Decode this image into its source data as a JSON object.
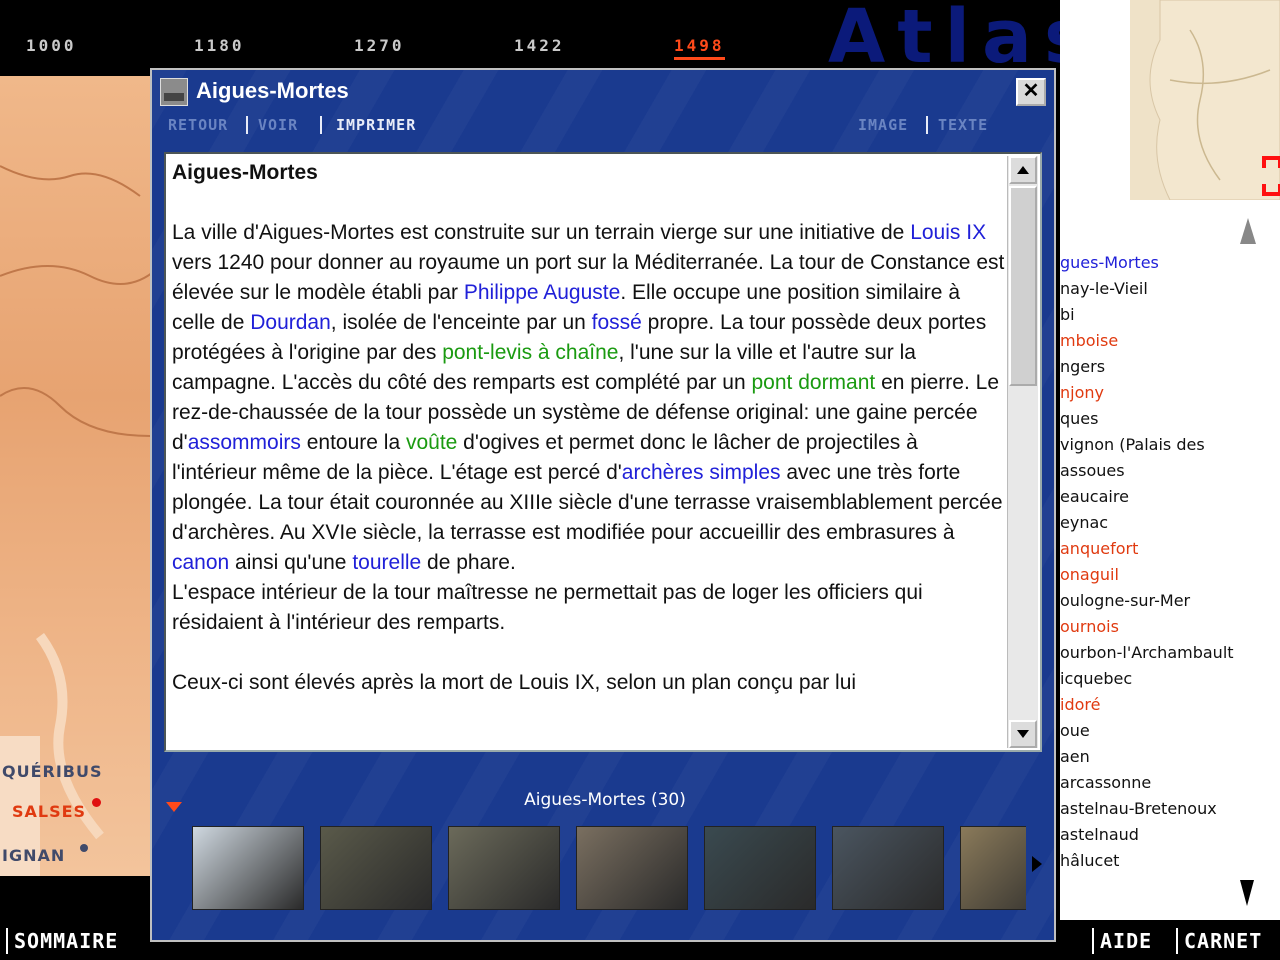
{
  "timeline": {
    "years": [
      "1000",
      "1180",
      "1270",
      "1422",
      "1498"
    ],
    "active": "1498",
    "logo": "Atlas"
  },
  "map_labels": {
    "queribus": "QUÉRIBUS",
    "salses": "SALSES",
    "ignan": "IGNAN"
  },
  "dialog": {
    "title": "Aigues-Mortes",
    "toolbar": {
      "retour": "RETOUR",
      "voir": "VOIR",
      "imprimer": "IMPRIMER",
      "image": "IMAGE",
      "texte": "TEXTE"
    },
    "close_label": "✕",
    "article": {
      "heading": "Aigues-Mortes",
      "segments": [
        {
          "t": "La ville d'Aigues-Mortes est construite sur un terrain vierge  sur une initiative de "
        },
        {
          "t": "Louis IX",
          "link": "blue"
        },
        {
          "t": " vers 1240 pour donner au royaume un port sur la Méditerranée. La tour de Constance est élevée sur le modèle établi par "
        },
        {
          "t": "Philippe Auguste",
          "link": "blue"
        },
        {
          "t": ". Elle occupe une position similaire à celle de "
        },
        {
          "t": "Dourdan",
          "link": "blue"
        },
        {
          "t": ", isolée de l'enceinte par un "
        },
        {
          "t": "fossé",
          "link": "blue"
        },
        {
          "t": " propre. La tour possède deux portes protégées à l'origine par des "
        },
        {
          "t": "pont-levis à chaîne",
          "link": "green"
        },
        {
          "t": ", l'une sur la ville et l'autre sur la campagne. L'accès du côté des remparts est complété par un "
        },
        {
          "t": "pont dormant",
          "link": "green"
        },
        {
          "t": " en pierre. Le rez-de-chaussée de la tour possède un système de défense original: une gaine percée d'"
        },
        {
          "t": "assommoirs",
          "link": "blue"
        },
        {
          "t": " entoure la "
        },
        {
          "t": "voûte",
          "link": "green"
        },
        {
          "t": " d'ogives et permet donc le lâcher de projectiles à l'intérieur même de la pièce. L'étage est percé d'"
        },
        {
          "t": "archères simples",
          "link": "blue"
        },
        {
          "t": " avec une très forte plongée. La tour était couronnée au XIIIe siècle d'une terrasse vraisemblablement percée d'archères. Au XVIe siècle, la terrasse est modifiée pour accueillir des embrasures à "
        },
        {
          "t": "canon",
          "link": "blue"
        },
        {
          "t": " ainsi qu'une "
        },
        {
          "t": "tourelle",
          "link": "blue"
        },
        {
          "t": " de phare."
        }
      ],
      "paragraph2": "L'espace intérieur de la tour maîtresse ne permettait pas de loger les officiers qui résidaient à l'intérieur des remparts.",
      "paragraph3": "Ceux-ci sont élevés après la mort de Louis IX, selon un plan conçu par lui"
    },
    "gallery": {
      "label": "Aigues-Mortes (30)",
      "thumb_colors": [
        "#cfd8e0",
        "#5a5a4a",
        "#6b6a5a",
        "#7a6f60",
        "#3a4a50",
        "#4a5560",
        "#8a7a5a"
      ]
    }
  },
  "site_list": [
    {
      "text": "gues-Mortes",
      "color": "#2020d8"
    },
    {
      "text": "nay-le-Vieil",
      "color": "#111111"
    },
    {
      "text": "bi",
      "color": "#111111"
    },
    {
      "text": "mboise",
      "color": "#e03a10"
    },
    {
      "text": "ngers",
      "color": "#111111"
    },
    {
      "text": "njony",
      "color": "#e03a10"
    },
    {
      "text": "ques",
      "color": "#111111"
    },
    {
      "text": "vignon (Palais des",
      "color": "#111111"
    },
    {
      "text": "assoues",
      "color": "#111111"
    },
    {
      "text": "eaucaire",
      "color": "#111111"
    },
    {
      "text": "eynac",
      "color": "#111111"
    },
    {
      "text": "anquefort",
      "color": "#e03a10"
    },
    {
      "text": "onaguil",
      "color": "#e03a10"
    },
    {
      "text": "oulogne-sur-Mer",
      "color": "#111111"
    },
    {
      "text": "ournois",
      "color": "#e03a10"
    },
    {
      "text": "ourbon-l'Archambault",
      "color": "#111111"
    },
    {
      "text": "icquebec",
      "color": "#111111"
    },
    {
      "text": "idoré",
      "color": "#e03a10"
    },
    {
      "text": "oue",
      "color": "#111111"
    },
    {
      "text": "aen",
      "color": "#111111"
    },
    {
      "text": "arcassonne",
      "color": "#111111"
    },
    {
      "text": "astelnau-Bretenoux",
      "color": "#111111"
    },
    {
      "text": "astelnaud",
      "color": "#111111"
    },
    {
      "text": "hâlucet",
      "color": "#111111"
    }
  ],
  "bottom": {
    "sommaire": "SOMMAIRE",
    "aide": "AIDE",
    "carnet": "CARNET"
  },
  "colors": {
    "accent": "#ff4a1a",
    "dialog_bg": "#1a3a8f",
    "link_blue": "#2020d8",
    "link_green": "#1a9a10"
  }
}
